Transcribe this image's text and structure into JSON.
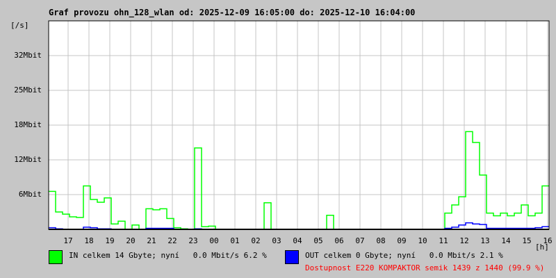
{
  "chart_data": {
    "type": "line",
    "title": "Graf provozu ohn_128_wlan od: 2025-12-09 16:05:00 do: 2025-12-10 16:04:00",
    "ylabel": "[/s]",
    "xlabel": "[h]",
    "ylim": [
      0,
      38.4
    ],
    "y_ticks": [
      {
        "value": 6.4,
        "label": "6Mbit"
      },
      {
        "value": 12.8,
        "label": "12Mbit"
      },
      {
        "value": 19.2,
        "label": "18Mbit"
      },
      {
        "value": 25.6,
        "label": "25Mbit"
      },
      {
        "value": 32,
        "label": "32Mbit"
      }
    ],
    "x_ticks": [
      "17",
      "18",
      "19",
      "20",
      "21",
      "22",
      "23",
      "00",
      "01",
      "02",
      "03",
      "04",
      "05",
      "06",
      "07",
      "08",
      "09",
      "10",
      "11",
      "12",
      "13",
      "14",
      "15",
      "16"
    ],
    "x_range_hours": [
      0,
      24
    ],
    "sample_minutes": 20,
    "grid": true,
    "series": [
      {
        "name": "IN",
        "color": "#00ff00",
        "values": [
          7,
          3.2,
          2.8,
          2.3,
          2.2,
          8,
          5.5,
          5,
          5.8,
          1,
          1.5,
          0,
          0.8,
          0,
          3.8,
          3.6,
          3.8,
          2,
          0.3,
          0.1,
          0,
          15,
          0.5,
          0.6,
          0,
          0,
          0,
          0,
          0,
          0,
          0,
          4.9,
          0,
          0,
          0,
          0,
          0,
          0,
          0,
          0,
          2.6,
          0,
          0,
          0,
          0,
          0,
          0,
          0,
          0,
          0,
          0,
          0,
          0,
          0,
          0,
          0,
          0,
          3,
          4.5,
          6,
          18,
          16,
          10,
          3,
          2.5,
          3,
          2.5,
          3,
          4.5,
          2.5,
          3,
          8
        ]
      },
      {
        "name": "OUT",
        "color": "#0000ff",
        "values": [
          0.3,
          0.1,
          0,
          0,
          0,
          0.4,
          0.3,
          0.1,
          0.1,
          0,
          0,
          0,
          0,
          0,
          0.2,
          0.2,
          0.2,
          0.2,
          0,
          0,
          0,
          0.1,
          0,
          0,
          0,
          0,
          0,
          0,
          0,
          0,
          0,
          0,
          0,
          0,
          0,
          0,
          0,
          0,
          0,
          0,
          0,
          0,
          0,
          0,
          0,
          0,
          0,
          0,
          0,
          0,
          0,
          0,
          0,
          0,
          0,
          0,
          0,
          0.2,
          0.4,
          0.8,
          1.2,
          1.0,
          0.9,
          0.2,
          0.2,
          0.2,
          0.2,
          0.2,
          0.2,
          0.2,
          0.3,
          0.5
        ]
      }
    ]
  },
  "legend": {
    "in_text": "IN celkem 14 Gbyte; nyní   0.0 Mbit/s 6.2 %",
    "out_text": "OUT celkem 0 Gbyte; nyní   0.0 Mbit/s 2.1 %",
    "availability": "Dostupnost E220 KOMPAKTOR semik 1439 z 1440 (99.9 %)",
    "availability_color": "#ff0000"
  }
}
